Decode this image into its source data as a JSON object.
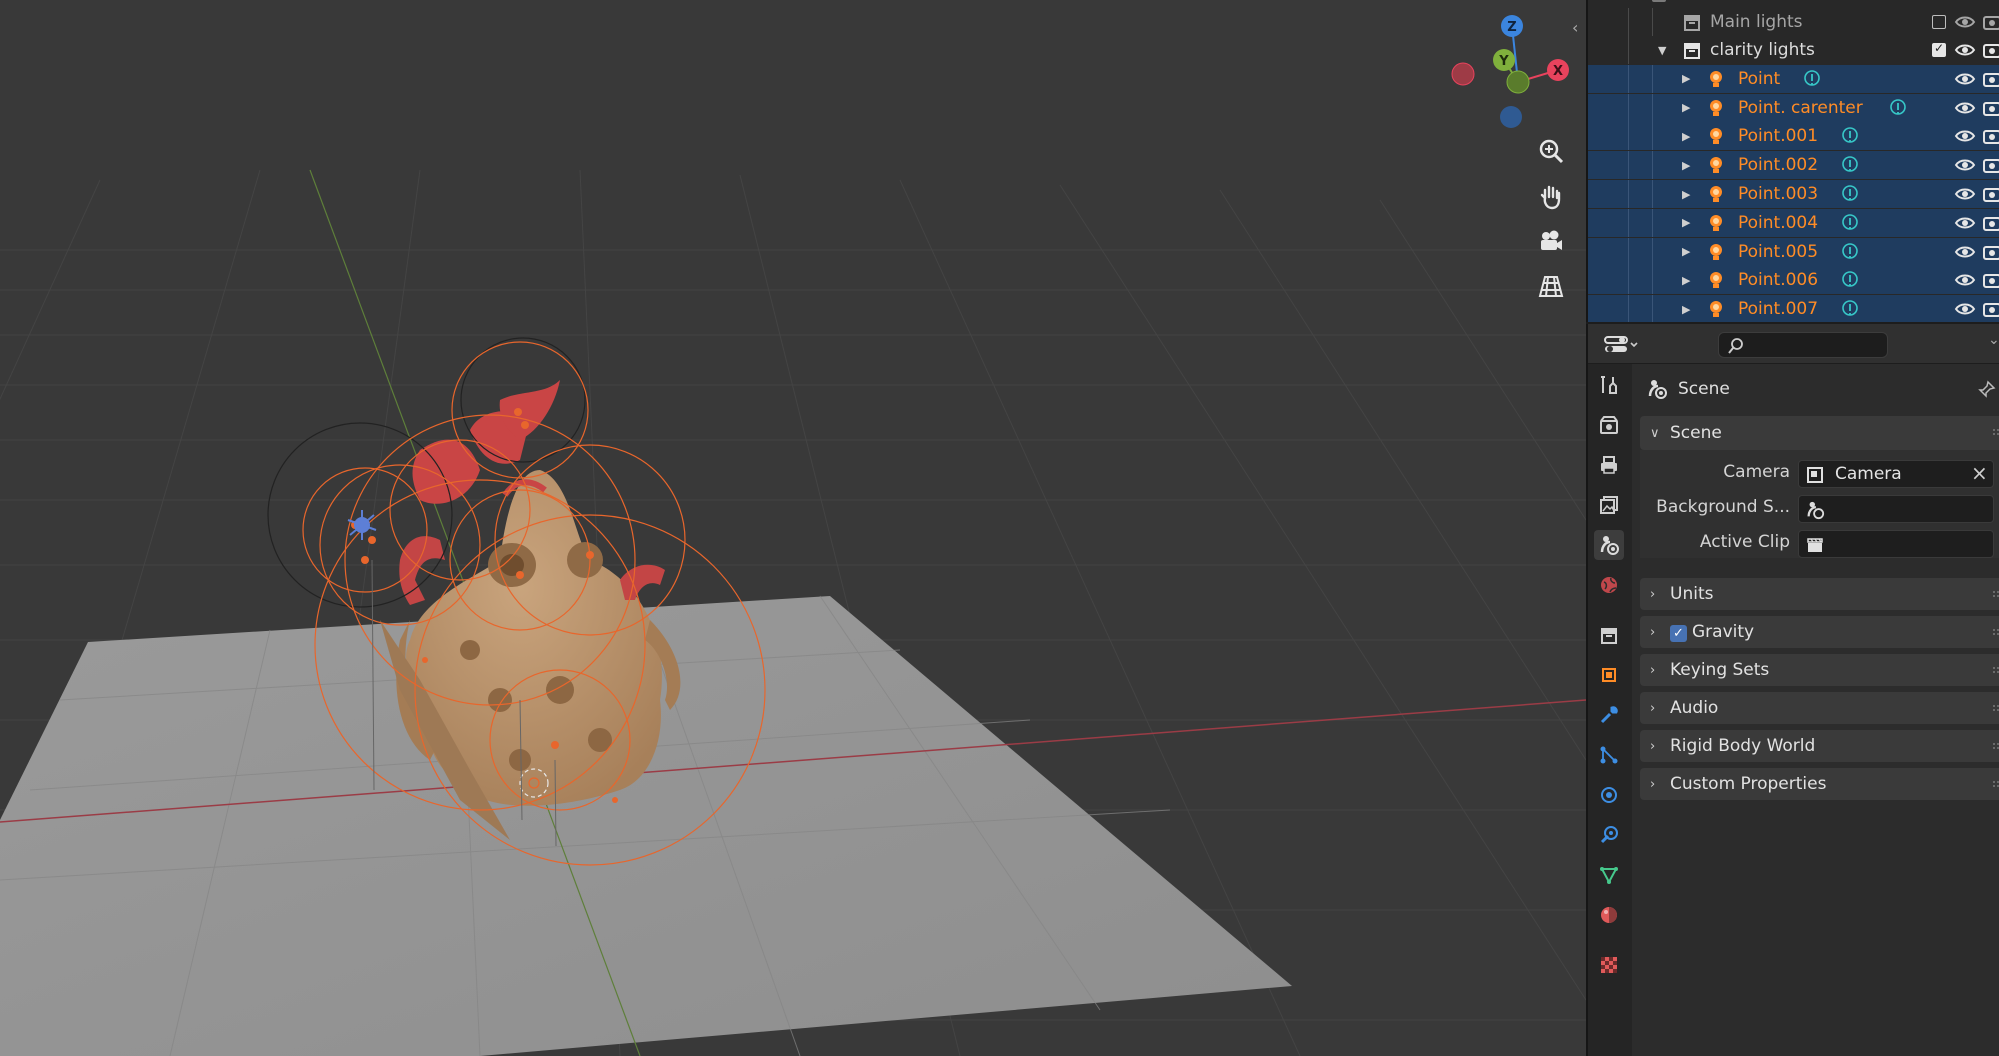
{
  "outliner": {
    "rows": [
      {
        "label": "Main lights",
        "kind": "collection",
        "expanded": false,
        "checked": false
      },
      {
        "label": "clarity lights",
        "kind": "collection",
        "expanded": true,
        "checked": true
      },
      {
        "label": "Point",
        "kind": "light"
      },
      {
        "label": "Point. carenter",
        "kind": "light"
      },
      {
        "label": "Point.001",
        "kind": "light"
      },
      {
        "label": "Point.002",
        "kind": "light"
      },
      {
        "label": "Point.003",
        "kind": "light"
      },
      {
        "label": "Point.004",
        "kind": "light"
      },
      {
        "label": "Point.005",
        "kind": "light"
      },
      {
        "label": "Point.006",
        "kind": "light"
      },
      {
        "label": "Point.007",
        "kind": "light"
      }
    ]
  },
  "gizmo": {
    "x": "X",
    "y": "Y",
    "z": "Z"
  },
  "properties": {
    "search_placeholder": "",
    "context_title": "Scene",
    "panels": {
      "scene": "Scene",
      "units": "Units",
      "gravity": "Gravity",
      "keying_sets": "Keying Sets",
      "audio": "Audio",
      "rigid_body_world": "Rigid Body World",
      "custom_properties": "Custom Properties"
    },
    "fields": {
      "camera_label": "Camera",
      "camera_value": "Camera",
      "background_label": "Background S...",
      "background_value": "",
      "active_clip_label": "Active Clip",
      "active_clip_value": ""
    },
    "gravity_enabled": true
  },
  "colors": {
    "viewport_bg": "#393939",
    "selection_highlight": "#1f3c5f",
    "light_name": "#ff8c26",
    "light_circle": "#e8662c",
    "axis_x": "#e8435d",
    "axis_y": "#7fb03c",
    "axis_z": "#3b85de"
  }
}
